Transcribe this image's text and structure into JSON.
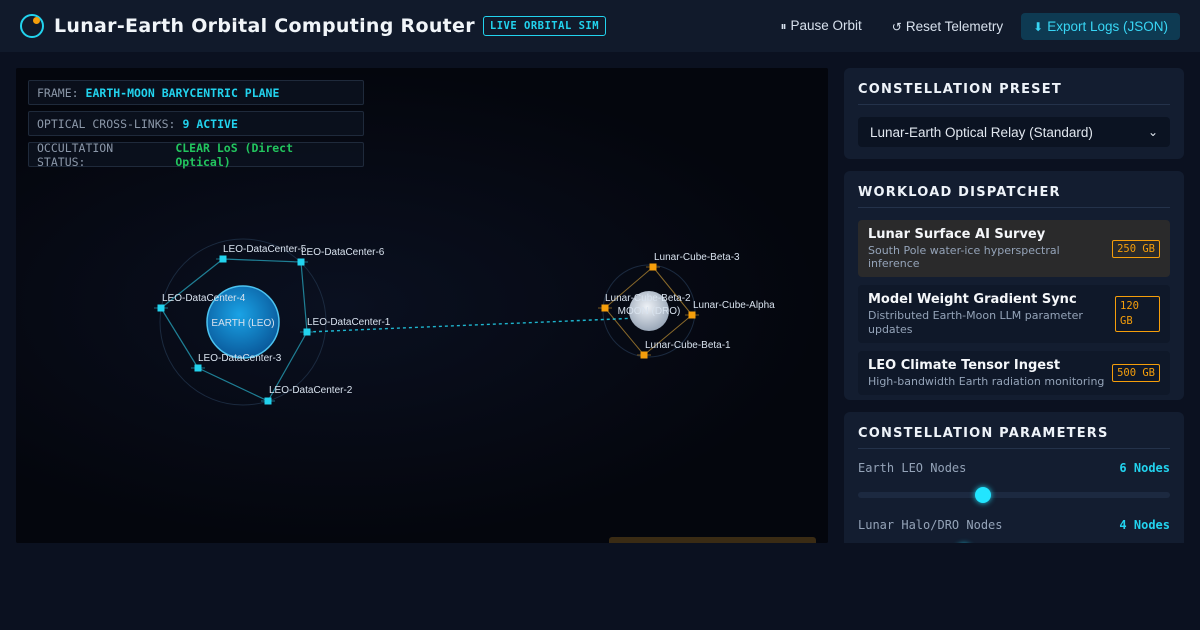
{
  "header": {
    "title": "Lunar-Earth Orbital Computing Router",
    "badge": "LIVE ORBITAL SIM",
    "pause_label": "Pause Orbit",
    "reset_label": "Reset Telemetry",
    "export_label": "Export Logs (JSON)",
    "pause_glyph": "⏸",
    "reset_glyph": "↺",
    "export_glyph": "⬇"
  },
  "hud": {
    "frame_key": "FRAME:",
    "frame_value": "EARTH-MOON BARYCENTRIC PLANE",
    "links_key": "OPTICAL CROSS-LINKS:",
    "links_value": "9 ACTIVE",
    "occ_key": "OCCULTATION STATUS:",
    "occ_value": "CLEAR LoS (Direct Optical)"
  },
  "scene": {
    "earth_label": "EARTH (LEO)",
    "moon_label": "MOON (DRO)",
    "earth_nodes": [
      "LEO-DataCenter-1",
      "LEO-DataCenter-2",
      "LEO-DataCenter-3",
      "LEO-DataCenter-4",
      "LEO-DataCenter-5",
      "LEO-DataCenter-6"
    ],
    "lunar_nodes": [
      "Lunar-Cube-Alpha",
      "Lunar-Cube-Beta-1",
      "Lunar-Cube-Beta-2",
      "Lunar-Cube-Beta-3"
    ],
    "colors": {
      "earth_node": "#22d3ee",
      "lunar_node": "#f59e0b",
      "link": "#22d3ee"
    }
  },
  "preset": {
    "title": "CONSTELLATION PRESET",
    "selected": "Lunar-Earth Optical Relay (Standard)"
  },
  "dispatcher": {
    "title": "WORKLOAD DISPATCHER",
    "jobs": [
      {
        "name": "Lunar Surface AI Survey",
        "desc": "South Pole water-ice hyperspectral inference",
        "size": "250 GB"
      },
      {
        "name": "Model Weight Gradient Sync",
        "desc": "Distributed Earth-Moon LLM parameter updates",
        "size": "120 GB"
      },
      {
        "name": "LEO Climate Tensor Ingest",
        "desc": "High-bandwidth Earth radiation monitoring",
        "size": "500 GB"
      }
    ]
  },
  "params": {
    "title": "CONSTELLATION PARAMETERS",
    "leo_label": "Earth LEO Nodes",
    "leo_value": "6 Nodes",
    "leo_level": 0.4,
    "lunar_label": "Lunar Halo/DRO Nodes",
    "lunar_value": "4 Nodes",
    "lunar_level": 0.34
  }
}
